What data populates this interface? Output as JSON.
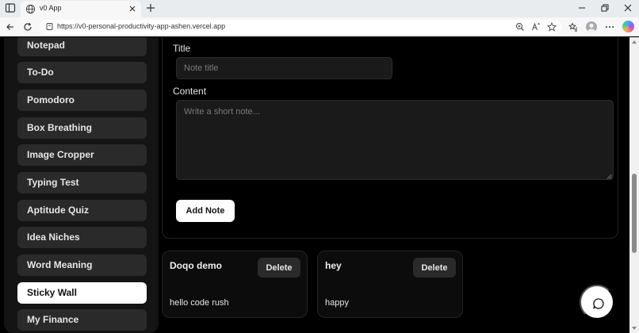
{
  "browser": {
    "tab_title": "v0 App",
    "url": "https://v0-personal-productivity-app-ashen.vercel.app"
  },
  "sidebar": {
    "items": [
      {
        "label": "Notepad"
      },
      {
        "label": "To-Do"
      },
      {
        "label": "Pomodoro"
      },
      {
        "label": "Box Breathing"
      },
      {
        "label": "Image Cropper"
      },
      {
        "label": "Typing Test"
      },
      {
        "label": "Aptitude Quiz"
      },
      {
        "label": "Idea Niches"
      },
      {
        "label": "Word Meaning"
      },
      {
        "label": "Sticky Wall",
        "active": true
      },
      {
        "label": "My Finance"
      }
    ]
  },
  "form": {
    "title_label": "Title",
    "title_placeholder": "Note title",
    "title_value": "",
    "content_label": "Content",
    "content_placeholder": "Write a short note...",
    "content_value": "",
    "add_label": "Add Note"
  },
  "notes": [
    {
      "title": "Doqo demo",
      "body": "hello code rush",
      "delete_label": "Delete"
    },
    {
      "title": "hey",
      "body": "happy",
      "delete_label": "Delete"
    }
  ],
  "icons": {
    "chat_button": "chat-bubble-icon"
  }
}
